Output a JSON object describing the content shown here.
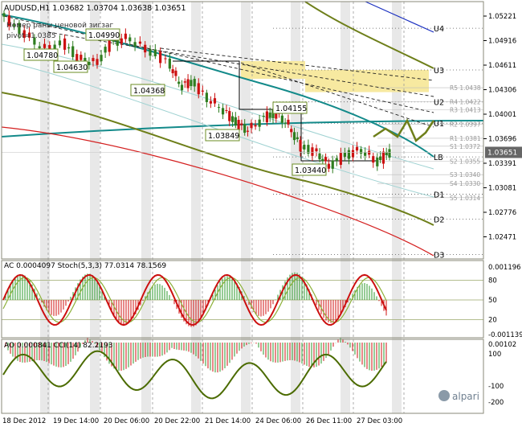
{
  "colors": {
    "background": "#ffffff",
    "frame": "#8a8a7a",
    "grid": "#9a9a9a",
    "bull": "#2e7d1f",
    "bear": "#cc1111",
    "annotation_green": "#6b8e23",
    "zone": "#f7e9a0",
    "ma_teal": "#138a8a",
    "ma_olive": "#6e7f1a",
    "ma_red": "#d42020",
    "ma_blue": "#1a2fc0",
    "stoch_main": "#cc1010",
    "stoch_signal": "#8db13a",
    "cci": "#4b6b00",
    "ac_up": "#2e9a2e",
    "ac_down": "#d01010"
  },
  "header": {
    "title": "AUDUSD,H1  1.03682 1.03704 1.03638 1.03651",
    "indicator_label": "Номер раны ценовой зигзаг",
    "pivot_label": "pivot=1.0385"
  },
  "chart_data": [
    {
      "type": "candlestick",
      "title": "AUDUSD,H1",
      "ohlc_current": {
        "open": 1.03682,
        "high": 1.03704,
        "low": 1.03638,
        "close": 1.03651
      },
      "last_price": "1.03651",
      "ylim": [
        1.0245,
        1.0535
      ],
      "x_labels": [
        "18 Dec 2012",
        "19 Dec 14:00",
        "20 Dec 06:00",
        "20 Dec 22:00",
        "21 Dec 14:00",
        "24 Dec 06:00",
        "26 Dec 11:00",
        "27 Dec 03:00"
      ],
      "y_ticks": [
        "1.05221",
        "1.04916",
        "1.04611",
        "1.04306",
        "1.04001",
        "1.03696",
        "1.03391",
        "1.03081",
        "1.02776",
        "1.02471"
      ],
      "price_labels": [
        "1.04780",
        "1.04990",
        "1.04630",
        "1.04368",
        "1.04155",
        "1.03849",
        "1.03440"
      ],
      "levels": [
        {
          "name": "U4",
          "value": 1.0505
        },
        {
          "name": "U3",
          "value": 1.0458
        },
        {
          "name": "U2",
          "value": 1.0422
        },
        {
          "name": "U1",
          "value": 1.0398
        },
        {
          "name": "LB",
          "value": 1.036
        },
        {
          "name": "D1",
          "value": 1.0318
        },
        {
          "name": "D2",
          "value": 1.029
        },
        {
          "name": "D3",
          "value": 1.025
        }
      ],
      "pivots": [
        {
          "name": "R5",
          "value": 1.0438
        },
        {
          "name": "R4",
          "value": 1.0422
        },
        {
          "name": "R3",
          "value": 1.0413
        },
        {
          "name": "R2",
          "value": 1.0397
        },
        {
          "name": "R1",
          "value": 1.0381
        },
        {
          "name": "S1",
          "value": 1.0372
        },
        {
          "name": "S2",
          "value": 1.0355
        },
        {
          "name": "S3",
          "value": 1.034
        },
        {
          "name": "S4",
          "value": 1.033
        },
        {
          "name": "S5",
          "value": 1.0314
        }
      ]
    },
    {
      "type": "line",
      "title": "AC 0.0004097  Stoch(5,3,3) 77.0314 78.1569",
      "series": [
        {
          "name": "AC",
          "kind": "histogram"
        },
        {
          "name": "Stoch main"
        },
        {
          "name": "Stoch signal"
        }
      ],
      "y_ticks": [
        "0.001196",
        "80",
        "50",
        "20",
        "-0.001139"
      ],
      "ylim": [
        0,
        100
      ]
    },
    {
      "type": "line",
      "title": "AO 0.000841  CCI(14) 82.2193",
      "series": [
        {
          "name": "AO",
          "kind": "histogram"
        },
        {
          "name": "CCI(14)"
        }
      ],
      "y_ticks": [
        "0.00102",
        "100",
        "-100",
        "-200"
      ],
      "ylim": [
        -250,
        150
      ]
    }
  ],
  "watermark": {
    "brand": "alpari"
  }
}
